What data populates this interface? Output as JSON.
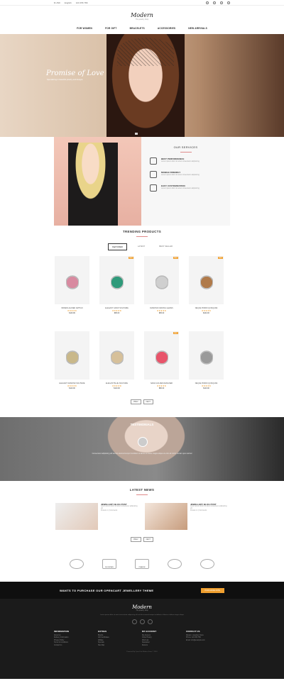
{
  "topbar": {
    "currency": "$ USD",
    "language": "English",
    "phone": "123 456 789",
    "icons": [
      "search-icon",
      "heart-icon",
      "cart-icon",
      "user-icon"
    ]
  },
  "brand": {
    "logo": "Modern",
    "tagline": "The jewelry shop"
  },
  "nav": [
    "FOR WOMEN",
    "FOR GIFT",
    "BRACELETS",
    "ACCESSORIES",
    "NEW ARRIVALS"
  ],
  "hero": {
    "title": "Promise of Love",
    "subtitle": "Specializing in beautiful jewelry and designs"
  },
  "services": {
    "title": "OUR SERVICES",
    "items": [
      {
        "title": "BEST PERFORMANCE",
        "desc": "Lorem ipsum dolor sit amet consectetur adipisicing"
      },
      {
        "title": "MOBILE FRIENDLY",
        "desc": "Lorem ipsum dolor sit amet consectetur adipisicing"
      },
      {
        "title": "EASY CUSTOMIZATION",
        "desc": "Lorem ipsum dolor sit amet consectetur adipisicing"
      }
    ]
  },
  "trending": {
    "title": "TRENDING PRODUCTS",
    "tabs": [
      "FEATURED",
      "LATEST",
      "BEST SELLER"
    ],
    "products": [
      {
        "name": "IMPERIA ALFRED NATHAN",
        "stars": "★★★★★",
        "price": "$116.99",
        "badge": ""
      },
      {
        "name": "ELEGANT CARAT SOLITAIRE",
        "stars": "★★★★★",
        "price": "$95.00",
        "badge": "SALE"
      },
      {
        "name": "DIAMOND CRAVING LEAVES",
        "stars": "★★★★★",
        "price": "$95.00",
        "badge": "SALE"
      },
      {
        "name": "NEQUE PORRO QUISQUAM",
        "stars": "★★★★★",
        "price": "$224.00",
        "badge": "SALE"
      },
      {
        "name": "ELEGANT DIAMOND SOLITAIRE",
        "stars": "★★★★★",
        "price": "$110.00",
        "badge": ""
      },
      {
        "name": "ELEGANT BLUE SOLITAIRE",
        "stars": "★★★★★",
        "price": "$110.00",
        "badge": ""
      },
      {
        "name": "NADIA GOLDEN DESIGNER",
        "stars": "★★★★★",
        "price": "$80.00",
        "badge": "SALE"
      },
      {
        "name": "NEQUE PORRO QUISQUAM",
        "stars": "★★★★★",
        "price": "$110.00",
        "badge": ""
      }
    ],
    "prev": "PREV",
    "next": "NEXT"
  },
  "testimonials": {
    "title": "TESTIMONIALS",
    "text": "Consectetur adipisicing elit sed do eiusmod tempor incididunt ut labore et dolore magna aliqua ut enim ad minim veniam quis nostrud"
  },
  "news": {
    "title": "LATEST NEWS",
    "items": [
      {
        "title": "JEWELLERY BLOG POST",
        "desc": "Lorem ipsum dolor sit amet consectetur adipisicing elit",
        "meta": "Posted on  |  Comments"
      },
      {
        "title": "JEWELLERY BLOG POST",
        "desc": "Lorem ipsum dolor sit amet consectetur adipisicing elit",
        "meta": "Posted on  |  Comments"
      }
    ],
    "prev": "PREV",
    "next": "NEXT"
  },
  "brands": [
    "MOUNTAIN",
    "",
    "PRAVER",
    "",
    ""
  ],
  "cta": {
    "text": "WANTS TO PURCHASE OUR OPENCART JEWELLERY THEME",
    "button": "PURCHASE NOW"
  },
  "footer": {
    "logo": "Modern",
    "sub": "The jewelry shop",
    "desc": "Lorem ipsum dolor sit amet consectetur adipisicing elit sed do eiusmod tempor incididunt ut labore et dolore magna aliqua",
    "cols": [
      {
        "title": "INFORMATION",
        "links": [
          "About Us",
          "Delivery Information",
          "Privacy Policy",
          "Terms & Conditions",
          "Contact Us"
        ]
      },
      {
        "title": "EXTRAS",
        "links": [
          "Brands",
          "Gift Certificates",
          "Affiliate",
          "Specials",
          "Site Map"
        ]
      },
      {
        "title": "MY ACCOUNT",
        "links": [
          "My Account",
          "Order History",
          "Wish List",
          "Newsletter",
          "Returns"
        ]
      },
      {
        "title": "CONTACT US",
        "links": [
          "Modern, Jewellery Store",
          "Phone: 123 456 789",
          "Email: info@example.com"
        ]
      }
    ],
    "copyright": "Powered By OpenCart Modern Store © 2016"
  }
}
